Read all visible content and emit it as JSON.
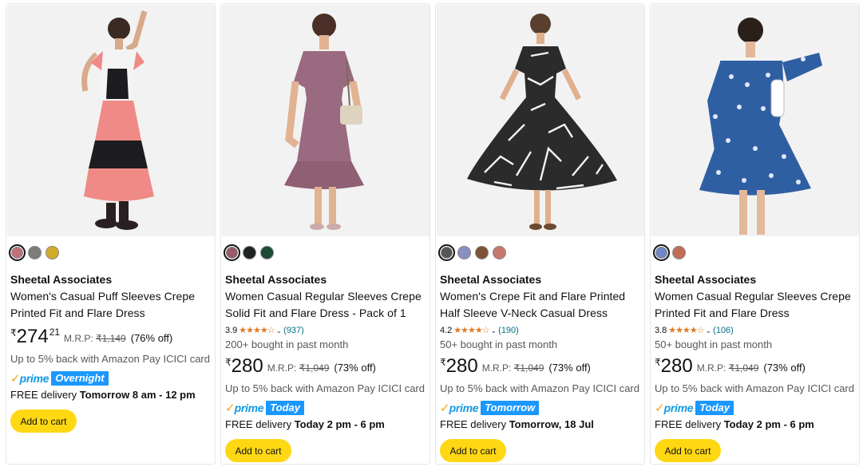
{
  "products": [
    {
      "swatches": [
        "#c4707a",
        "#7c7c7c",
        "#d1ac2a"
      ],
      "brand": "Sheetal Associates",
      "title_line1": "Women's Casual Puff Sleeves Crepe",
      "title_line2": "Printed Fit and Flare Dress",
      "price_symbol": "₹",
      "price_whole": "274",
      "price_fraction": "21",
      "mrp_label": "M.R.P:",
      "mrp_value": "₹1,149",
      "discount": "(76% off)",
      "cashback": "Up to 5% back with Amazon Pay ICICI card",
      "prime_word": "prime",
      "prime_tag": "Overnight",
      "delivery_prefix": "FREE delivery",
      "delivery_time": "Tomorrow 8 am - 12 pm",
      "cart_label": "Add to cart",
      "image_icon": "dress-photo-pink-print"
    },
    {
      "swatches": [
        "#9b5a6c",
        "#1f2420",
        "#1f4a35"
      ],
      "brand": "Sheetal Associates",
      "title_line1": "Women Casual Regular Sleeves Crepe",
      "title_line2": "Solid Fit and Flare Dress - Pack of 1",
      "rating_value": "3.9",
      "rating_fraction": 0.78,
      "rating_count": "(937)",
      "bought": "200+ bought in past month",
      "price_symbol": "₹",
      "price_whole": "280",
      "mrp_label": "M.R.P:",
      "mrp_value": "₹1,049",
      "discount": "(73% off)",
      "cashback": "Up to 5% back with Amazon Pay ICICI card",
      "prime_word": "prime",
      "prime_tag": "Today",
      "delivery_prefix": "FREE delivery",
      "delivery_time": "Today 2 pm - 6 pm",
      "cart_label": "Add to cart",
      "image_icon": "dress-photo-mauve"
    },
    {
      "swatches": [
        "#555555",
        "#8a8fc2",
        "#7d5236",
        "#c7776c"
      ],
      "brand": "Sheetal Associates",
      "title_line1": "Women's Crepe Fit and Flare Printed",
      "title_line2": "Half Sleeve V-Neck Casual Dress",
      "rating_value": "4.2",
      "rating_fraction": 0.84,
      "rating_count": "(190)",
      "bought": "50+ bought in past month",
      "price_symbol": "₹",
      "price_whole": "280",
      "mrp_label": "M.R.P:",
      "mrp_value": "₹1,049",
      "discount": "(73% off)",
      "cashback": "Up to 5% back with Amazon Pay ICICI card",
      "prime_word": "prime",
      "prime_tag": "Tomorrow",
      "delivery_prefix": "FREE delivery",
      "delivery_time": "Tomorrow, 18 Jul",
      "cart_label": "Add to cart",
      "image_icon": "dress-photo-black-white-print"
    },
    {
      "swatches": [
        "#6f86c9",
        "#c36c55"
      ],
      "brand": "Sheetal Associates",
      "title_line1": "Women Casual Regular Sleeves Crepe",
      "title_line2": "Printed Fit and Flare Dress",
      "rating_value": "3.8",
      "rating_fraction": 0.76,
      "rating_count": "(106)",
      "bought": "50+ bought in past month",
      "price_symbol": "₹",
      "price_whole": "280",
      "mrp_label": "M.R.P:",
      "mrp_value": "₹1,049",
      "discount": "(73% off)",
      "cashback": "Up to 5% back with Amazon Pay ICICI card",
      "prime_word": "prime",
      "prime_tag": "Today",
      "delivery_prefix": "FREE delivery",
      "delivery_time": "Today 2 pm - 6 pm",
      "cart_label": "Add to cart",
      "image_icon": "dress-photo-blue-floral"
    }
  ],
  "colors": {
    "cart_button": "#ffd814",
    "star": "#de7921",
    "prime_blue": "#1399e3",
    "prime_check": "#f7a31c",
    "link": "#007185"
  }
}
